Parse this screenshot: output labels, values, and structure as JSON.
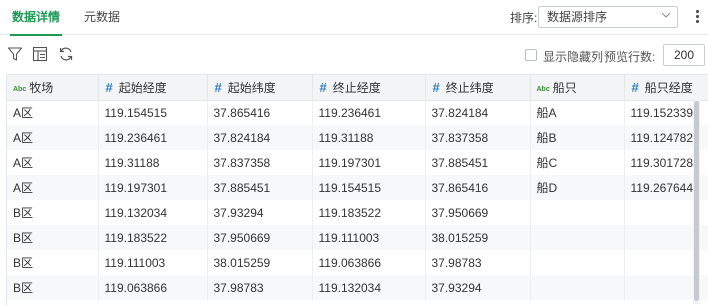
{
  "tabs": [
    {
      "label": "数据详情"
    },
    {
      "label": "元数据"
    }
  ],
  "sort": {
    "label": "排序:",
    "value": "数据源排序"
  },
  "toolbar": {
    "show_hidden_label": "显示隐藏列",
    "preview_rows_label": "预览行数:",
    "preview_rows_value": "200"
  },
  "table": {
    "columns": [
      {
        "type": "Abc",
        "name": "牧场"
      },
      {
        "type": "#",
        "name": "起始经度"
      },
      {
        "type": "#",
        "name": "起始纬度"
      },
      {
        "type": "#",
        "name": "终止经度"
      },
      {
        "type": "#",
        "name": "终止纬度"
      },
      {
        "type": "Abc",
        "name": "船只"
      },
      {
        "type": "#",
        "name": "船只经度"
      }
    ],
    "rows": [
      [
        "A区",
        "119.154515",
        "37.865416",
        "119.236461",
        "37.824184",
        "船A",
        "119.152339"
      ],
      [
        "A区",
        "119.236461",
        "37.824184",
        "119.31188",
        "37.837358",
        "船B",
        "119.124782"
      ],
      [
        "A区",
        "119.31188",
        "37.837358",
        "119.197301",
        "37.885451",
        "船C",
        "119.301728"
      ],
      [
        "A区",
        "119.197301",
        "37.885451",
        "119.154515",
        "37.865416",
        "船D",
        "119.267644"
      ],
      [
        "B区",
        "119.132034",
        "37.93294",
        "119.183522",
        "37.950669",
        "",
        ""
      ],
      [
        "B区",
        "119.183522",
        "37.950669",
        "119.111003",
        "38.015259",
        "",
        ""
      ],
      [
        "B区",
        "119.111003",
        "38.015259",
        "119.063866",
        "37.98783",
        "",
        ""
      ],
      [
        "B区",
        "119.063866",
        "37.98783",
        "119.132034",
        "37.93294",
        "",
        ""
      ]
    ]
  },
  "colors": {
    "accent": "#1e9a57",
    "numeric_type": "#2f7fc5",
    "text_type": "#3a8d3a"
  },
  "icons": [
    "filter-icon",
    "columns-icon",
    "refresh-icon",
    "more-vertical-icon",
    "chevron-down-icon"
  ]
}
